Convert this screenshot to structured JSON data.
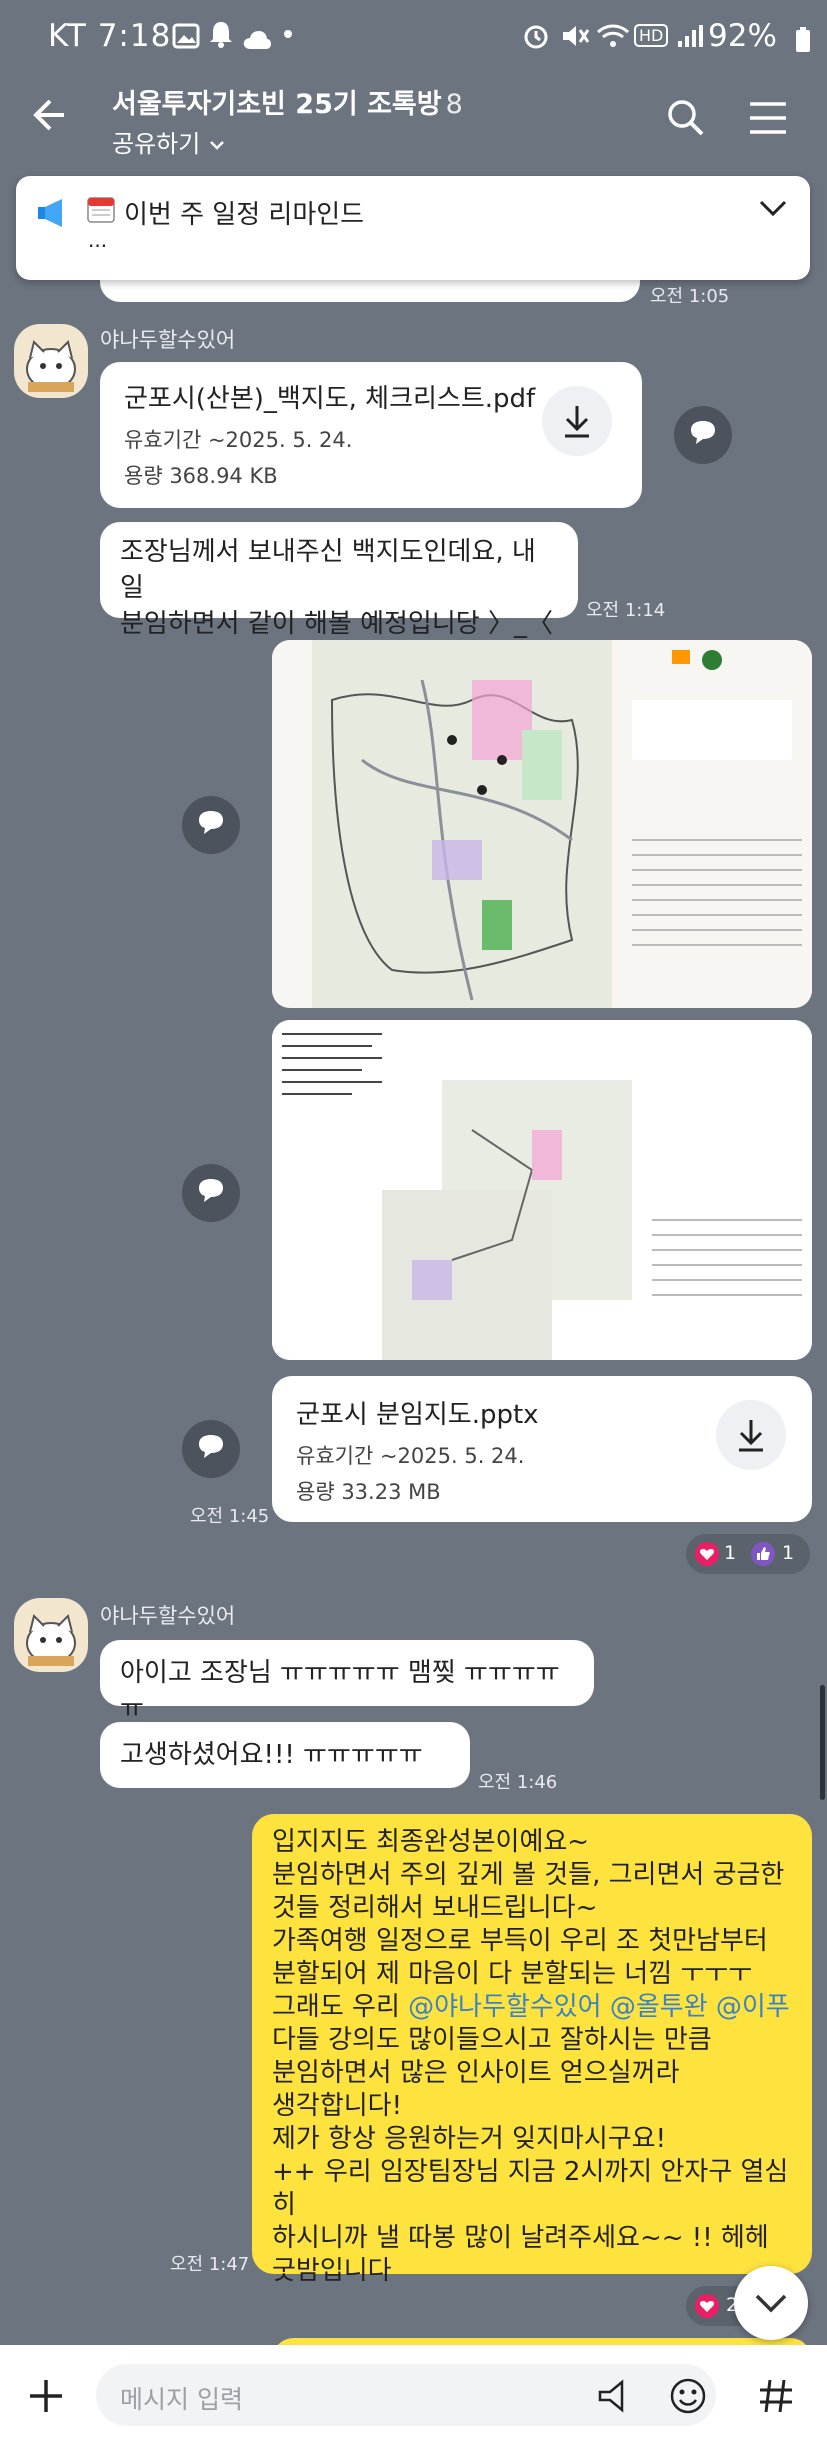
{
  "status": {
    "carrier_time": "KT 7:18",
    "battery": "92%"
  },
  "header": {
    "title": "서울투자기초빈 25기 조톡방",
    "member_count": "8",
    "share_label": "공유하기"
  },
  "notice": {
    "text": "이번 주 일정 리마인드",
    "dots": "..."
  },
  "times": {
    "t1": "오전 1:05",
    "t2": "오전 1:14",
    "t3": "오전 1:45",
    "t4": "오전 1:46",
    "t5": "오전 1:47"
  },
  "sender": {
    "name1": "야나두할수있어",
    "name2": "야나두할수있어"
  },
  "file1": {
    "title": "군포시(산본)_백지도, 체크리스트.pdf",
    "expiry": "유효기간 ~2025. 5. 24.",
    "size": "용량  368.94 KB"
  },
  "msg1": {
    "line1": "조장님께서 보내주신 백지도인데요, 내일",
    "line2": "분임하면서 같이 해볼 예정입니당 〉_〈"
  },
  "file2": {
    "title": "군포시 분임지도.pptx",
    "expiry": "유효기간 ~2025. 5. 24.",
    "size": "용량  33.23 MB"
  },
  "reactions": {
    "heart": "1",
    "thumb": "1"
  },
  "msg2": {
    "text": "아이고 조장님 ㅠㅠㅠㅠㅠ 맴찢 ㅠㅠㅠㅠㅠ"
  },
  "msg3": {
    "text": "고생하셨어요!!! ㅠㅠㅠㅠㅠ"
  },
  "my_msg": {
    "l1": "입지지도 최종완성본이예요~",
    "l2": "분임하면서 주의 깊게 볼 것들, 그리면서 궁금한",
    "l3": "것들 정리해서 보내드립니다~",
    "l4": "가족여행 일정으로 부득이 우리 조 첫만남부터",
    "l5": "분할되어 제 마음이 다 분할되는 너낌 ㅜㅜㅜ",
    "l6a": "그래도 우리 ",
    "m1": "@야나두할수있어",
    "m2": "@올투완",
    "m3": "@이푸",
    "l7": "다들 강의도 많이들으시고 잘하시는 만큼",
    "l8": "분임하면서 많은 인사이트 얻으실꺼라",
    "l9": "생각합니다!",
    "l10": "제가 항상 응원하는거 잊지마시구요!",
    "l11": "++ 우리 임장팀장님 지금 2시까지 안자구 열심히",
    "l12": "하시니까 낼 따봉 많이 날려주세요~~ !! 헤헤",
    "l13": "굿밤입니다"
  },
  "partial_reaction": "2",
  "input": {
    "placeholder": "메시지 입력"
  },
  "colors": {
    "bg": "#6c7480",
    "my_bubble": "#fee33f",
    "mention": "#3a82c7"
  }
}
